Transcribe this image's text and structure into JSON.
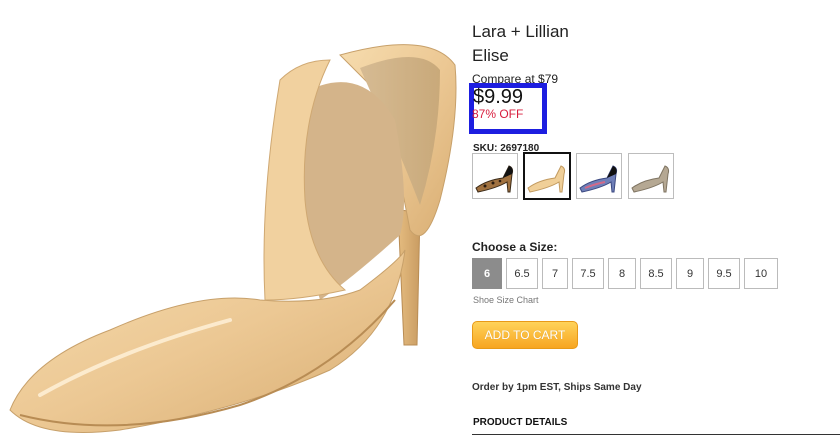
{
  "product": {
    "brand": "Lara + Lillian",
    "name": "Elise",
    "compare_at": "Compare at $79",
    "price": "$9.99",
    "discount": "87% OFF",
    "sku": "SKU: 2697180",
    "image_icon": "nude-patent-pump-image"
  },
  "colors": {
    "accent_highlight": "#1d1ee0",
    "discount_red": "#d81e3e",
    "cart_orange": "#f7a521",
    "selected_size_gray": "#8c8c8c"
  },
  "swatches": [
    {
      "icon": "leopard-pump-swatch",
      "selected": false
    },
    {
      "icon": "nude-pump-swatch",
      "selected": true
    },
    {
      "icon": "blue-pump-swatch",
      "selected": false
    },
    {
      "icon": "taupe-pump-swatch",
      "selected": false
    }
  ],
  "size_selector": {
    "heading": "Choose a Size:",
    "sizes": [
      "6",
      "6.5",
      "7",
      "7.5",
      "8",
      "8.5",
      "9",
      "9.5",
      "10"
    ],
    "selected": "6",
    "chart_link": "Shoe Size Chart"
  },
  "cart": {
    "add_label": "ADD TO CART",
    "order_note": "Order by 1pm EST, Ships Same Day"
  },
  "details": {
    "heading": "PRODUCT DETAILS"
  }
}
